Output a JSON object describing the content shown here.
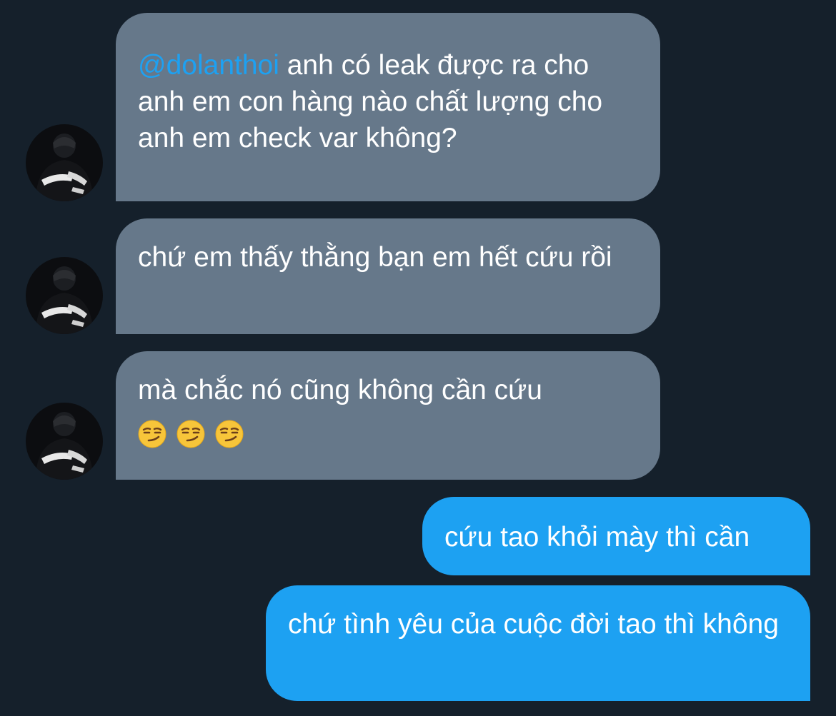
{
  "colors": {
    "background": "#15202b",
    "incoming_bubble": "#66788a",
    "outgoing_bubble": "#1da1f2",
    "mention": "#1da1f2",
    "text": "#ffffff"
  },
  "messages": [
    {
      "direction": "incoming",
      "mention": "@dolanthoi",
      "text": " anh có leak được ra cho anh em con hàng nào chất lượng cho anh em check var không?",
      "avatar": "sender-avatar"
    },
    {
      "direction": "incoming",
      "text": "chứ em thấy thằng bạn em hết cứu rồi",
      "avatar": "sender-avatar"
    },
    {
      "direction": "incoming",
      "text": "mà chắc nó cũng không cần cứu",
      "emojis": [
        "smirking-face-emoji",
        "smirking-face-emoji",
        "smirking-face-emoji"
      ],
      "avatar": "sender-avatar"
    },
    {
      "direction": "outgoing",
      "text": "cứu tao khỏi mày thì cần"
    },
    {
      "direction": "outgoing",
      "text": "chứ tình yêu của cuộc đời tao thì không"
    }
  ]
}
